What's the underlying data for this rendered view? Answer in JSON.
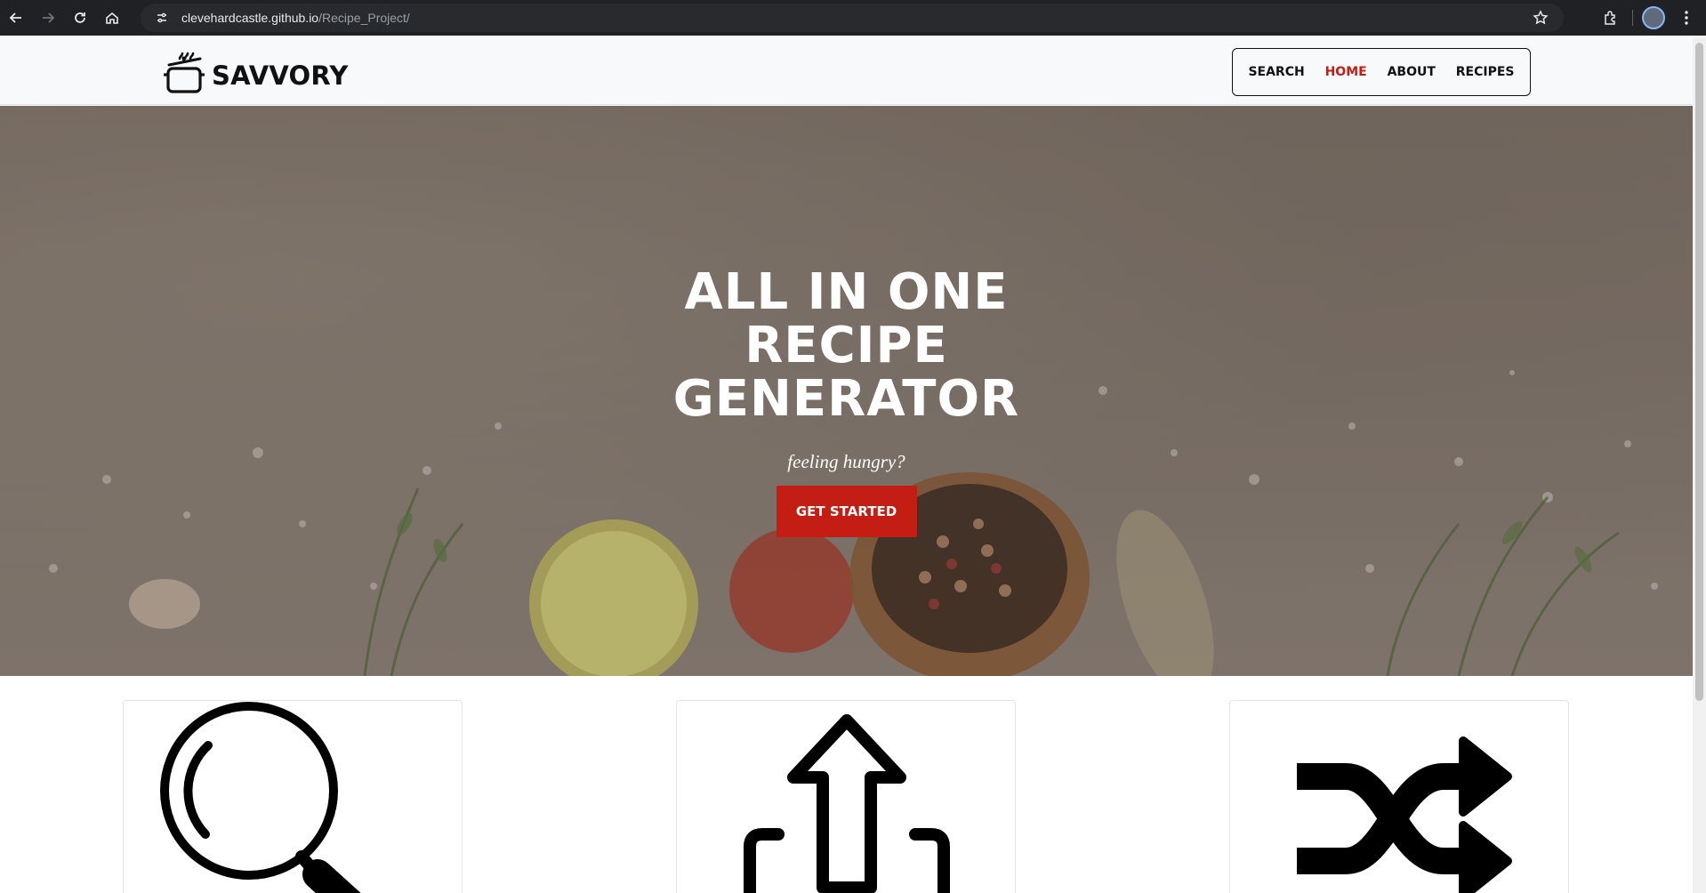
{
  "browser": {
    "url_host": "clevehardcastle.github.io",
    "url_path": "/Recipe_Project/"
  },
  "site": {
    "brand": "SAVVORY",
    "nav": [
      "SEARCH",
      "HOME",
      "ABOUT",
      "RECIPES"
    ],
    "active_nav": "HOME"
  },
  "hero": {
    "title": "ALL IN ONE RECIPE GENERATOR",
    "subtitle": "feeling hungry?",
    "cta_label": "GET STARTED"
  },
  "features": [
    {
      "icon": "search-icon"
    },
    {
      "icon": "share-upload-icon"
    },
    {
      "icon": "shuffle-icon"
    }
  ],
  "colors": {
    "accent": "#c41e14",
    "header_bg": "#f8f9fa",
    "chrome_bg": "#202124"
  }
}
